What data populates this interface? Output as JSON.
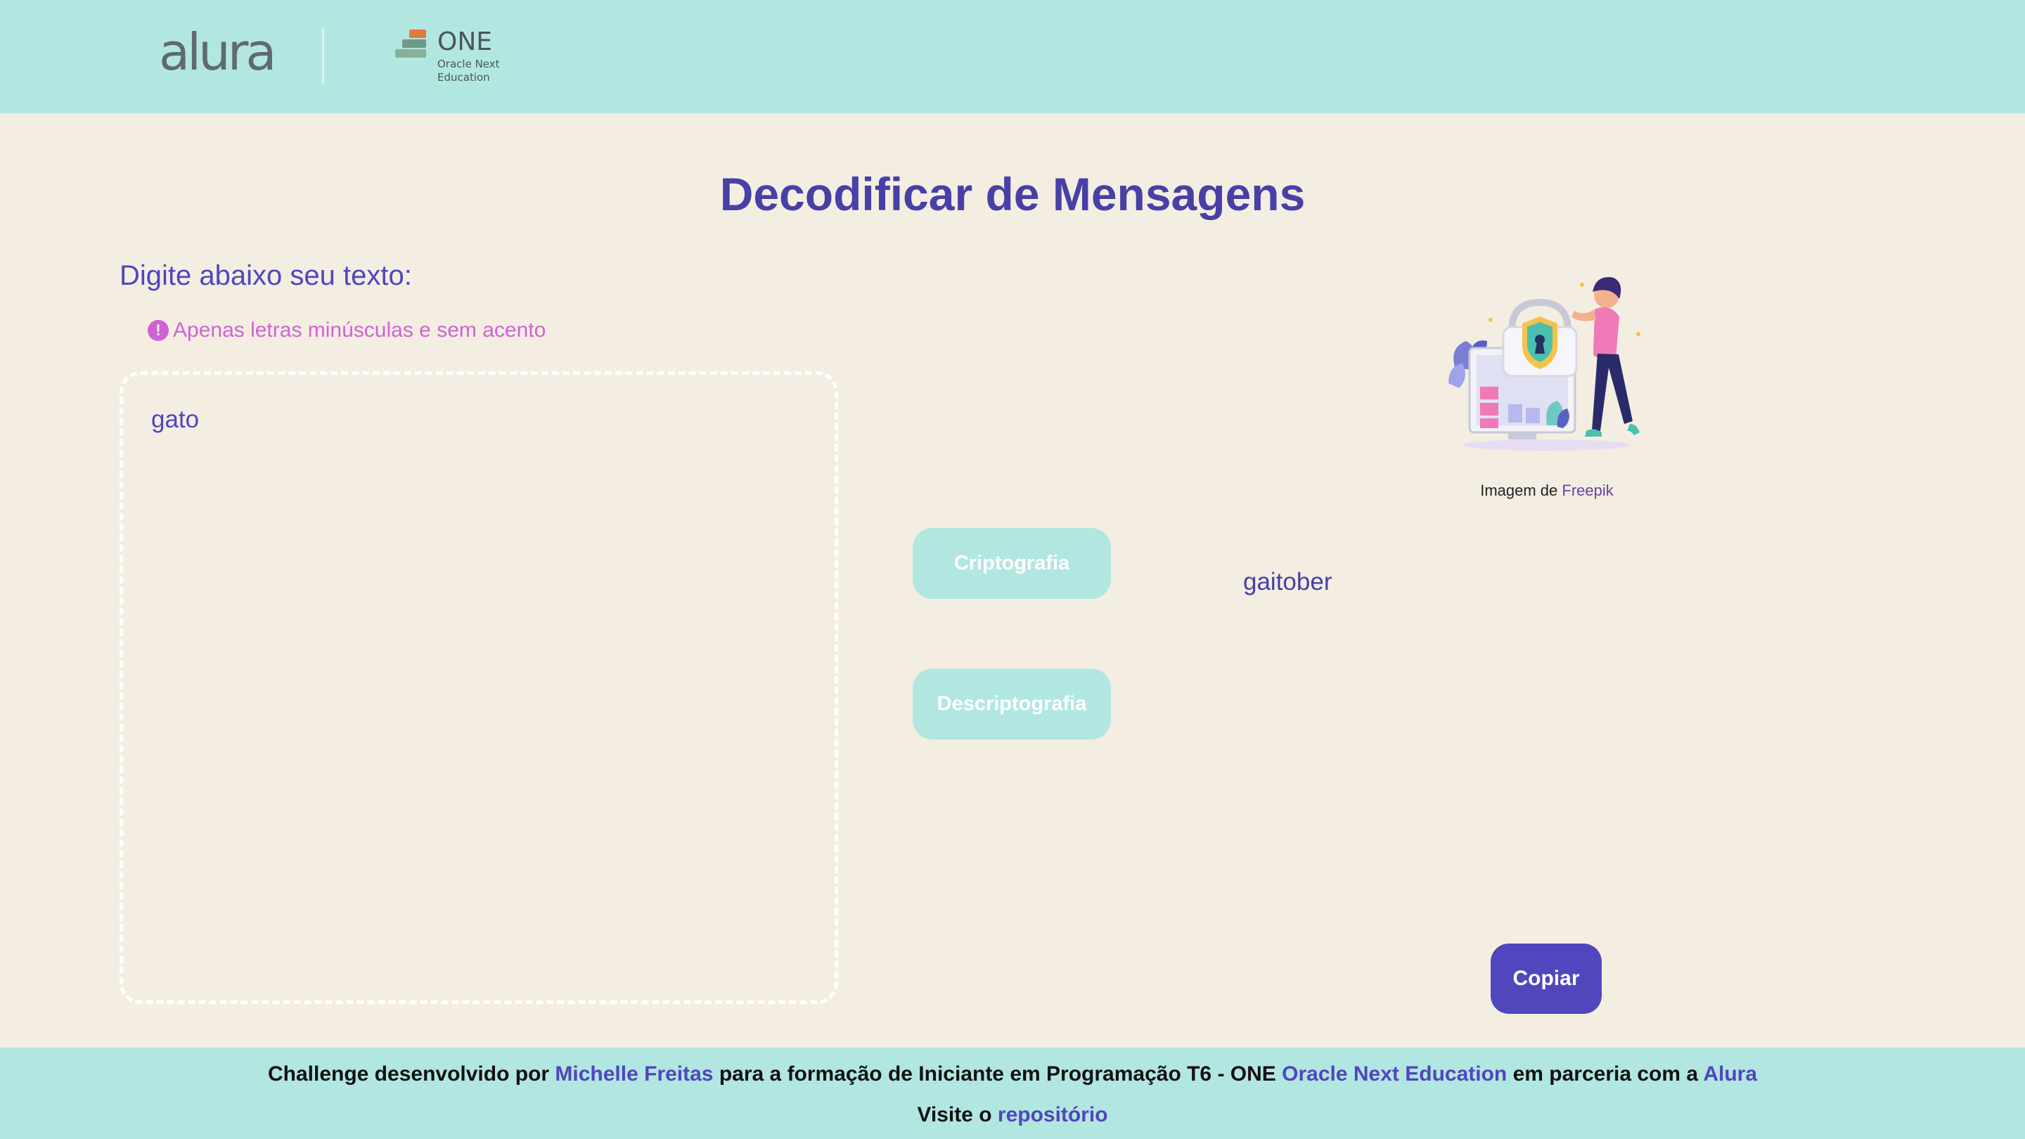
{
  "header": {
    "alura_logo": "alura",
    "one_logo": {
      "title": "ONE",
      "subtitle_line1": "Oracle Next",
      "subtitle_line2": "Education"
    }
  },
  "main": {
    "title": "Decodificar de Mensagens",
    "input_label": "Digite abaixo seu texto:",
    "warning_icon": "!",
    "warning_text": "Apenas letras minúsculas e sem acento",
    "input_value": "gato",
    "encrypt_label": "Criptografia",
    "decrypt_label": "Descriptografia",
    "output_text": "gaitober",
    "image_credit_prefix": "Imagem de",
    "image_credit_link": "Freepik",
    "copy_label": "Copiar"
  },
  "footer": {
    "t1": "Challenge desenvolvido por",
    "author": "Michelle Freitas",
    "t2": "para a formação de Iniciante em Programação T6 - ONE",
    "program": "Oracle Next Education",
    "t3": "em parceria com a",
    "partner": "Alura",
    "visit": "Visite o",
    "repo": "repositório"
  },
  "colors": {
    "header_bg": "#b2e7e1",
    "page_bg": "#f4eee2",
    "primary": "#5046be",
    "title": "#4840a6",
    "warning": "#d063d3",
    "button_light": "#b2e7e1"
  }
}
